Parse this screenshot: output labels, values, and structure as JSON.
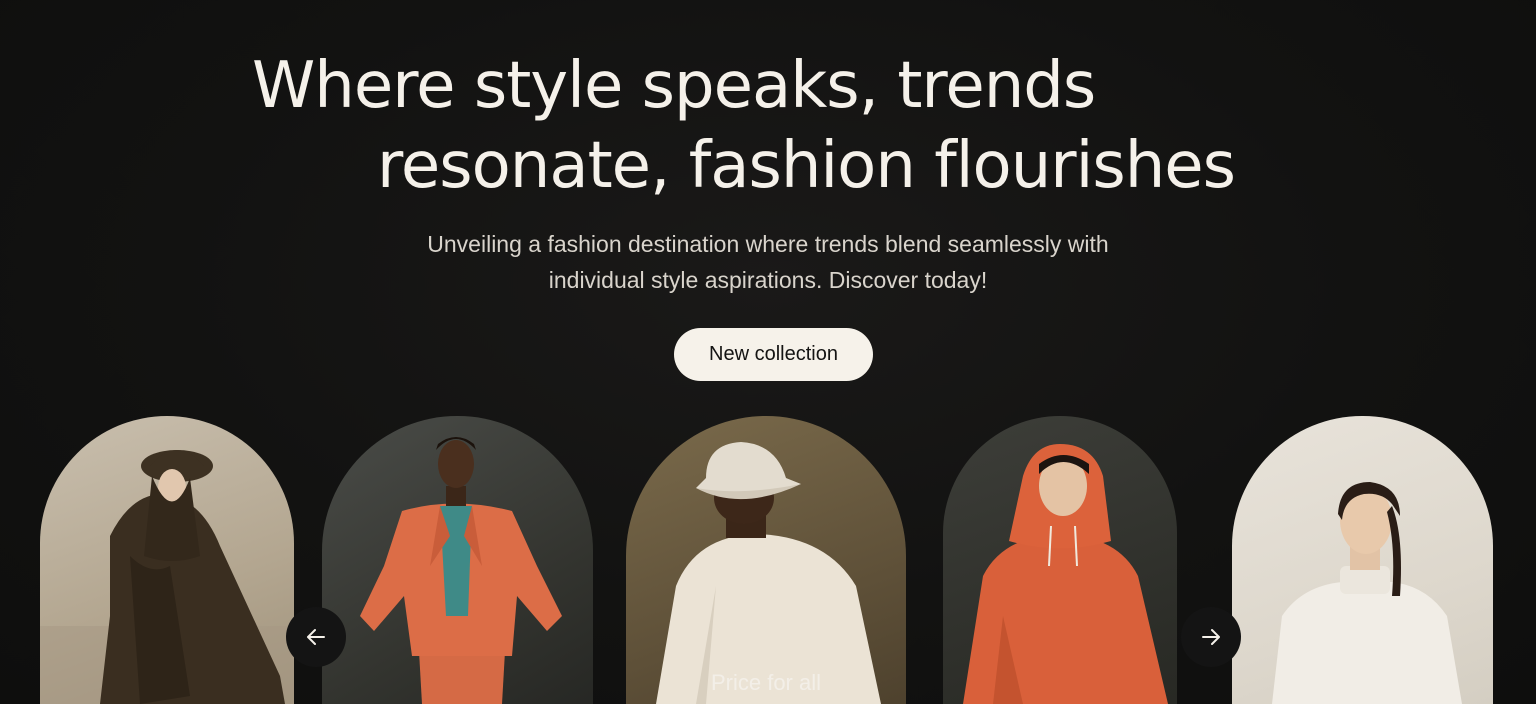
{
  "hero": {
    "title_line1": "Where style speaks, trends",
    "title_line2": "resonate, fashion flourishes",
    "subtitle_line1": "Unveiling a fashion destination where trends blend seamlessly with",
    "subtitle_line2": "individual style aspirations. Discover today!",
    "cta_label": "New collection"
  },
  "carousel": {
    "prev_icon": "arrow-left-icon",
    "next_icon": "arrow-right-icon",
    "caption": "Price for all",
    "cards": [
      {
        "subject": "person in dark brown hooded coat and bucket hat"
      },
      {
        "subject": "man in orange suit with teal shirt"
      },
      {
        "subject": "person in cream sweatshirt and bucket hat, back view"
      },
      {
        "subject": "person in orange hoodie"
      },
      {
        "subject": "woman in white turtleneck"
      }
    ]
  },
  "colors": {
    "background": "#121211",
    "text": "#f5f1ea",
    "button_bg": "#f6f2ea",
    "button_text": "#141413",
    "accent_orange": "#d9603a"
  }
}
